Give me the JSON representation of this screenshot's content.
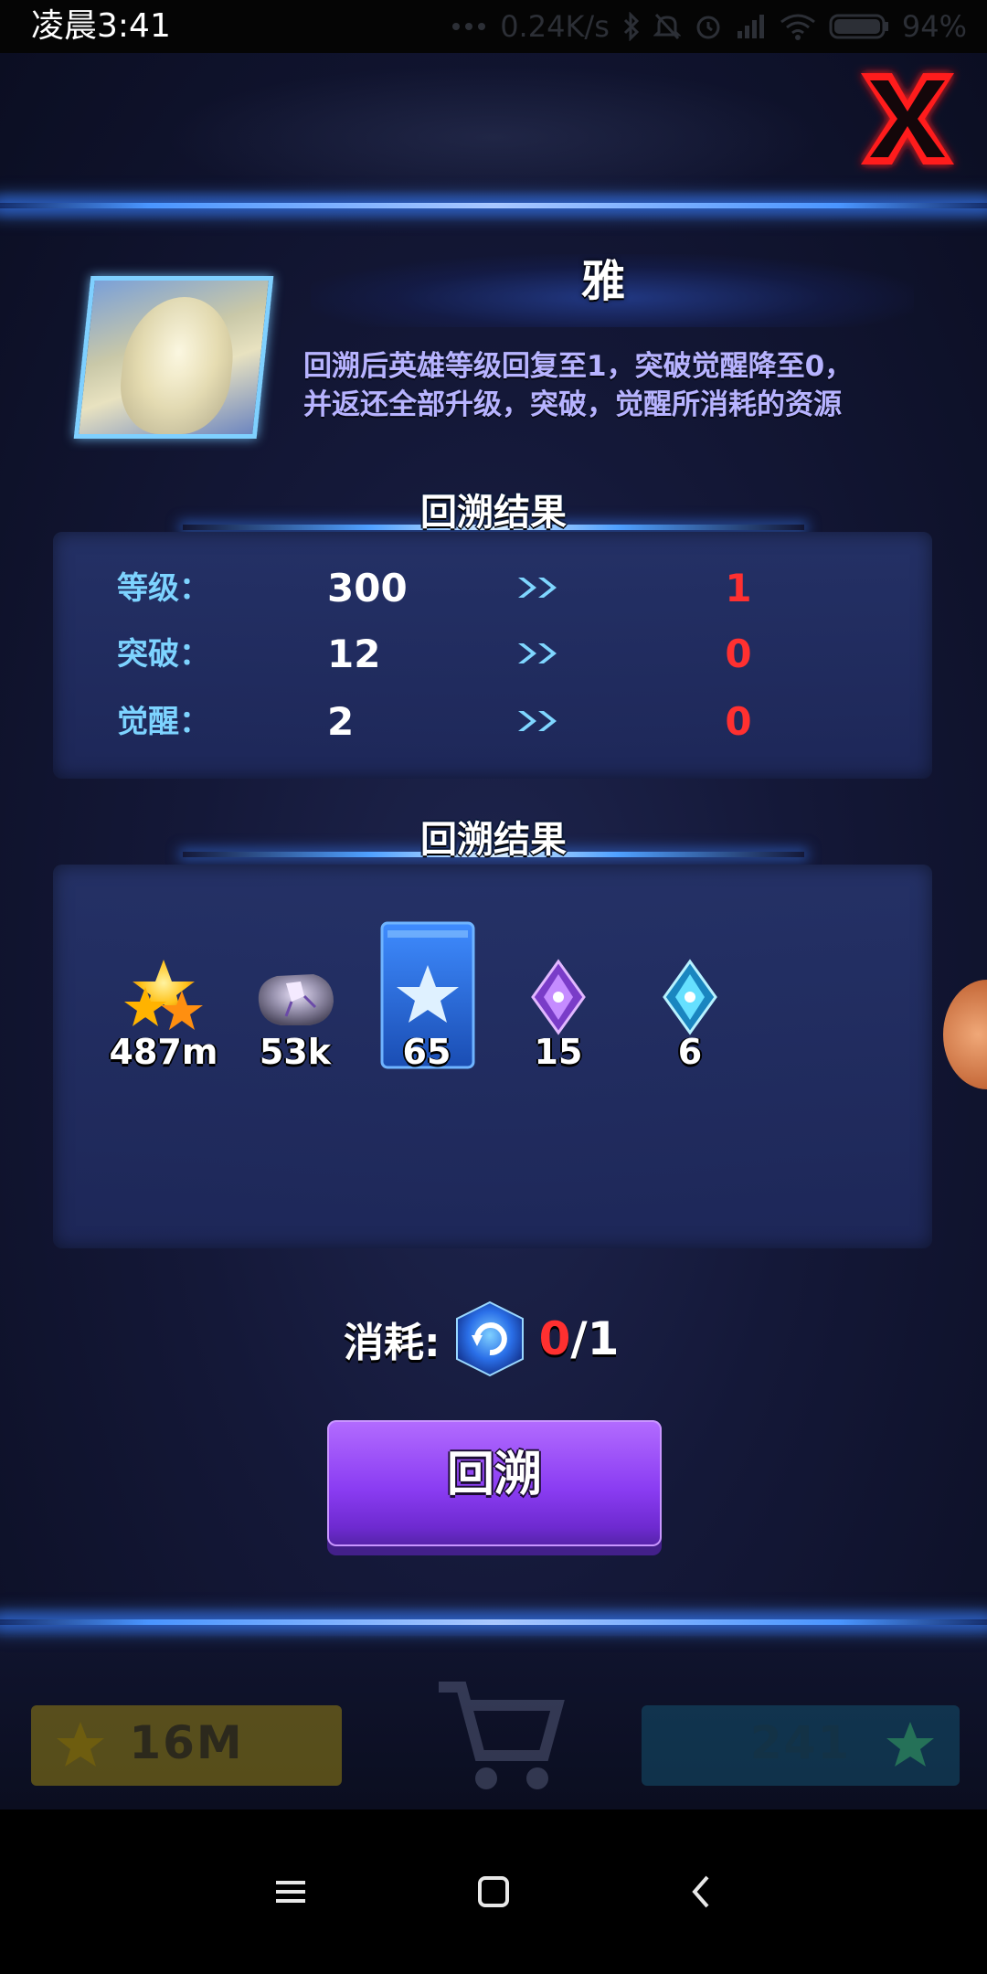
{
  "status_bar": {
    "time": "凌晨3:41",
    "network_speed": "0.24K/s",
    "battery": "94%",
    "icons": [
      "more-dots-icon",
      "bluetooth-icon",
      "mute-icon",
      "alarm-icon",
      "signal-icon",
      "wifi-icon",
      "battery-icon"
    ]
  },
  "hero": {
    "name": "雅",
    "description": "回溯后英雄等级回复至1，突破觉醒降至0，\n并返还全部升级，突破，觉醒所消耗的资源"
  },
  "stats_section": {
    "title": "回溯结果",
    "rows": [
      {
        "label": "等级：",
        "old": "300",
        "new": "1"
      },
      {
        "label": "突破：",
        "old": "12",
        "new": "0"
      },
      {
        "label": "觉醒：",
        "old": "2",
        "new": "0"
      }
    ]
  },
  "resources_section": {
    "title": "回溯结果",
    "items": [
      {
        "icon": "gold-stars-icon",
        "count": "487m"
      },
      {
        "icon": "ore-stone-icon",
        "count": "53k"
      },
      {
        "icon": "star-card-icon",
        "count": "65"
      },
      {
        "icon": "purple-crystal-icon",
        "count": "15"
      },
      {
        "icon": "cyan-crystal-icon",
        "count": "6"
      }
    ]
  },
  "cost": {
    "label": "消耗:",
    "icon": "rewind-cube-icon",
    "have": "0",
    "need": "/1"
  },
  "action_button": {
    "label": "回溯"
  },
  "background_bar": {
    "left_value": "16M",
    "right_value": "241"
  },
  "colors": {
    "accent_blue": "#5aa8ff",
    "label_cyan": "#7dd3ff",
    "desc_lavender": "#b7b3ff",
    "new_value_red": "#ff3030",
    "button_purple": "#8a3cf2",
    "close_red": "#ff1010"
  }
}
